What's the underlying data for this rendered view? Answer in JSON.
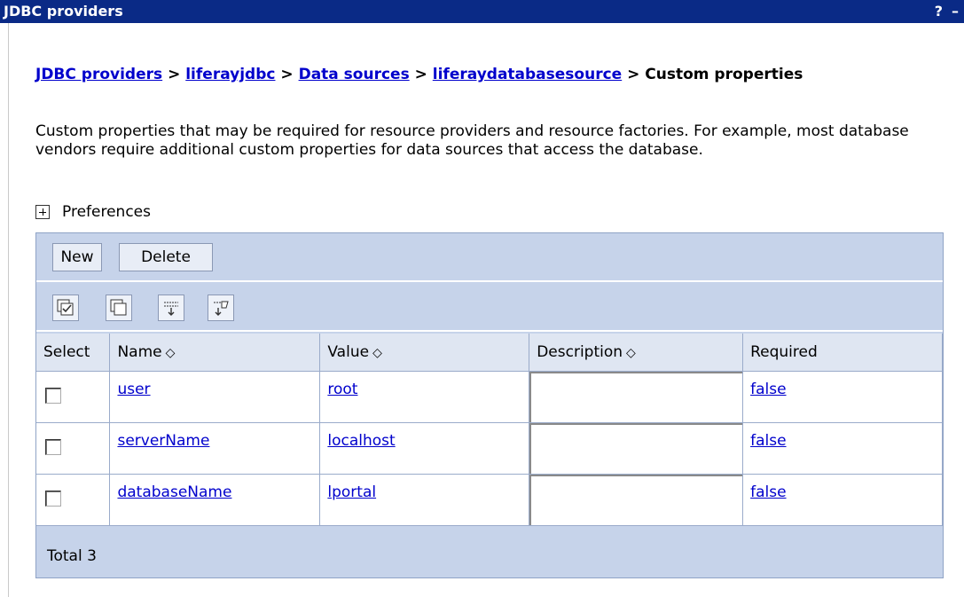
{
  "window": {
    "title": "JDBC providers",
    "help": "?",
    "minimize": "–"
  },
  "breadcrumb": {
    "links": [
      "JDBC providers",
      "liferayjdbc",
      "Data sources",
      "liferaydatabasesource"
    ],
    "separator": ">",
    "current": "Custom properties"
  },
  "description": "Custom properties that may be required for resource providers and resource factories. For example, most database vendors require additional custom properties for data sources that access the database.",
  "preferences_label": "Preferences",
  "toolbar": {
    "new_label": "New",
    "delete_label": "Delete"
  },
  "icons": [
    "select-all-icon",
    "deselect-all-icon",
    "show-filter-icon",
    "clear-filter-icon"
  ],
  "table": {
    "headers": {
      "select": "Select",
      "name": "Name",
      "value": "Value",
      "description": "Description",
      "required": "Required"
    },
    "sort_glyph": "◇",
    "rows": [
      {
        "name": "user",
        "value": "root",
        "description": "",
        "required": "false"
      },
      {
        "name": "serverName",
        "value": "localhost",
        "description": "",
        "required": "false"
      },
      {
        "name": "databaseName",
        "value": "lportal",
        "description": "",
        "required": "false"
      }
    ],
    "total": "Total 3"
  },
  "colors": {
    "titlebar": "#0a2a86",
    "panel": "#c6d3ea",
    "header": "#dfe6f2",
    "link": "#0000cc"
  }
}
